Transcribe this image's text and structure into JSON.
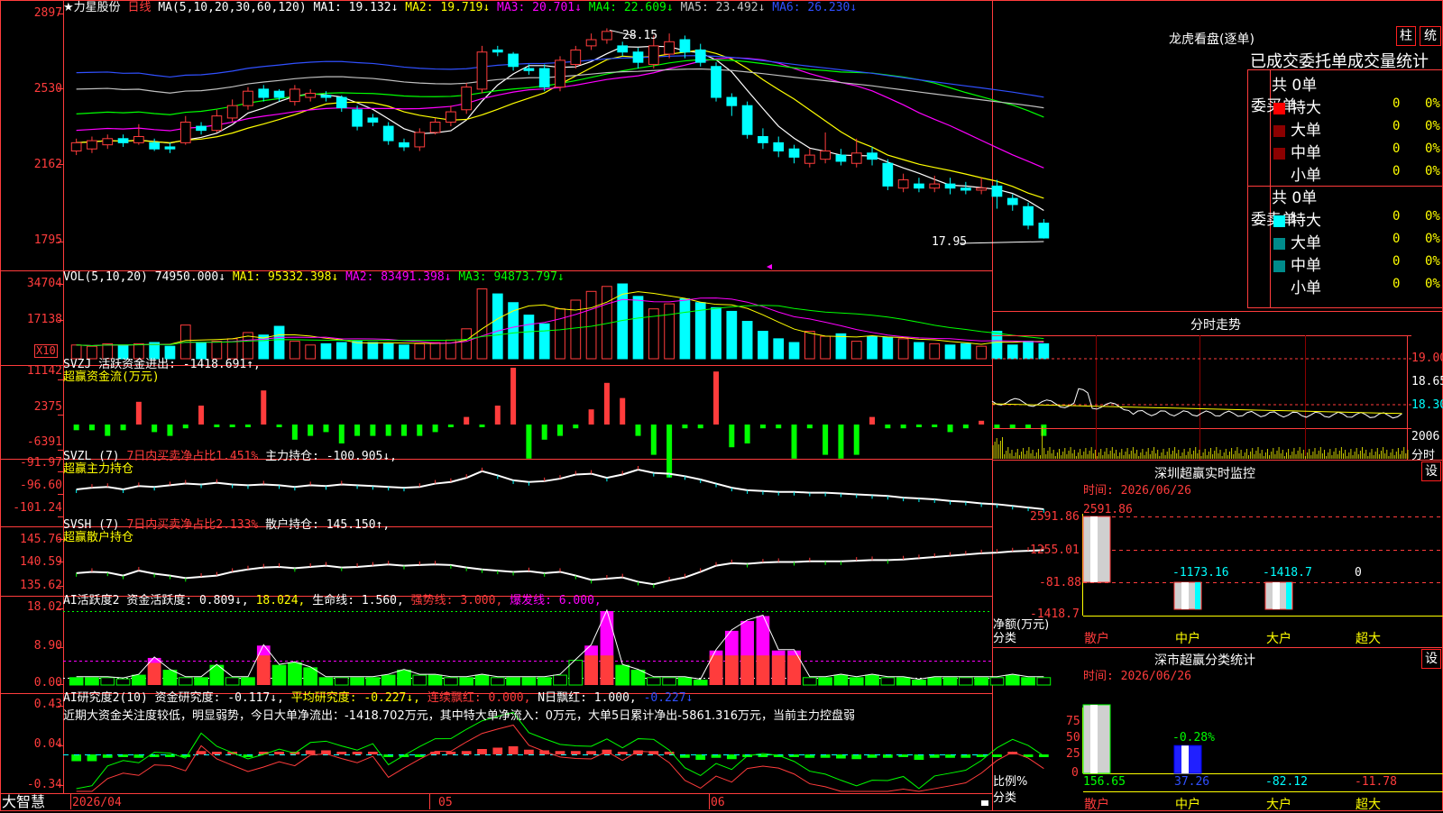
{
  "stock": {
    "name": "★力星股份",
    "period": "日线"
  },
  "main_panel": {
    "ma_header": "MA(5,10,20,30,60,120)",
    "ma1": "MA1: 19.132↓",
    "ma2": "MA2: 19.719↓",
    "ma3": "MA3: 20.701↓",
    "ma4": "MA4: 22.609↓",
    "ma5": "MA5: 23.492↓",
    "ma6": "MA6: 26.230↓",
    "y_ticks": [
      "2897",
      "2530",
      "2162",
      "1795"
    ],
    "high_marker": "28.15",
    "low_marker": "17.95"
  },
  "vol_panel": {
    "header": "VOL(5,10,20)",
    "value": "74950.000↓",
    "ma1": "MA1: 95332.398↓",
    "ma2": "MA2: 83491.398↓",
    "ma3": "MA3: 94873.797↓",
    "y_ticks": [
      "34704",
      "17138"
    ],
    "unit": "X10"
  },
  "svzj_panel": {
    "line1_name": "SVZJ",
    "line1_value": "活跃资金进出: -1418.691↑,",
    "line2": "超赢资金流(万元)",
    "y_ticks": [
      "11142",
      "2375",
      "-6391"
    ]
  },
  "svzl_panel": {
    "name": "SVZL (7)",
    "ratio": "7日内买卖净占比1.451%",
    "hold": "主力持仓: -100.905↓,",
    "line2": "超赢主力持仓",
    "y_ticks": [
      "-91.97",
      "-96.60",
      "-101.24"
    ]
  },
  "svsh_panel": {
    "name": "SVSH (7)",
    "ratio": "7日内买卖净占比2.133%",
    "hold": "散户持仓: 145.150↑,",
    "line2": "超赢散户持仓",
    "y_ticks": [
      "145.76",
      "140.59",
      "135.62"
    ]
  },
  "ai_active_panel": {
    "name": "AI活跃度2",
    "activity": "资金活跃度: 0.809↓,",
    "v2": "18.024,",
    "life": "生命线: 1.560,",
    "strong": "强势线: 3.000,",
    "burst": "爆发线: 6.000,",
    "y_ticks": [
      "18.02",
      "8.90",
      "0.00"
    ]
  },
  "ai_research_panel": {
    "name": "AI研究度2(10)",
    "research": "资金研究度: -0.117↓,",
    "avg": "平均研究度: -0.227↓,",
    "red": "连续飘红: 0.000,",
    "nred": "N日飘红: 1.000,",
    "last": "-0.227↓",
    "comment": "近期大资金关注度较低，明显弱势，今日大单净流出：-1418.702万元，其中特大单净流入：0万元，大单5日累计净出-5861.316万元，当前主力控盘弱",
    "y_ticks": [
      "0.43",
      "0.04",
      "-0.34"
    ]
  },
  "x_axis": {
    "brand": "大智慧",
    "date1": "2026/04",
    "date2": "05",
    "date3": "06"
  },
  "dragon_tiger": {
    "title": "龙虎看盘(逐单)",
    "btn_col": "柱",
    "btn_stat": "统",
    "subtitle": "已成交委托单成交量统计",
    "buy_label": "委买单",
    "sell_label": "委卖单",
    "buy_total": "共 0单",
    "sell_total": "共 0单",
    "rows": [
      {
        "label": "特大",
        "count": "0",
        "pct": "0%"
      },
      {
        "label": "大单",
        "count": "0",
        "pct": "0%"
      },
      {
        "label": "中单",
        "count": "0",
        "pct": "0%"
      },
      {
        "label": "小单",
        "count": "0",
        "pct": "0%"
      }
    ],
    "colors": {
      "buy": [
        "#ff0000",
        "#8b0000",
        "#8b0000"
      ],
      "sell": [
        "#00ffff",
        "#008b8b",
        "#008b8b"
      ]
    }
  },
  "intraday": {
    "title": "分时走势",
    "right_ticks": [
      "19.00",
      "18.65",
      "18.30",
      "2006"
    ],
    "label_min": "分时"
  },
  "monitor": {
    "title": "深圳超赢实时监控",
    "btn": "设",
    "time": "时间: 2026/06/26",
    "y_ticks": [
      "2591.86",
      "1255.01",
      "-81.88",
      "-1418.7"
    ],
    "y_label": "净额(万元)",
    "x_label": "分类",
    "bars": [
      {
        "cat": "散户",
        "value": 2591.86,
        "label": "2591.86"
      },
      {
        "cat": "中户",
        "value": -1173.16,
        "label": "-1173.16"
      },
      {
        "cat": "大户",
        "value": -1418.7,
        "label": "-1418.7"
      },
      {
        "cat": "超大",
        "value": 0,
        "label": "0"
      }
    ]
  },
  "classify": {
    "title": "深市超赢分类统计",
    "btn": "设",
    "time": "时间: 2026/06/26",
    "y_ticks": [
      "75",
      "50",
      "25",
      "0"
    ],
    "y_label": "比例%",
    "x_label": "分类",
    "bars": [
      {
        "cat": "散户",
        "value": 156.65,
        "label": "156.65"
      },
      {
        "cat": "中户",
        "value": 37.26,
        "label": "37.26",
        "annot": "-0.28%"
      },
      {
        "cat": "大户",
        "value": -82.12,
        "label": "-82.12"
      },
      {
        "cat": "超大",
        "value": -11.78,
        "label": "-11.78"
      }
    ]
  },
  "chart_data": {
    "type": "candlestick",
    "title": "力星股份 日线",
    "y_range_price": [
      17.95,
      28.97
    ],
    "candles": [
      {
        "o": 22.2,
        "c": 22.6,
        "h": 22.8,
        "l": 22.0
      },
      {
        "o": 22.3,
        "c": 22.7,
        "h": 22.9,
        "l": 22.1
      },
      {
        "o": 22.5,
        "c": 22.8,
        "h": 23.0,
        "l": 22.3
      },
      {
        "o": 22.8,
        "c": 22.6,
        "h": 23.0,
        "l": 22.4
      },
      {
        "o": 22.6,
        "c": 22.9,
        "h": 23.5,
        "l": 22.5
      },
      {
        "o": 22.6,
        "c": 22.3,
        "h": 22.8,
        "l": 22.2
      },
      {
        "o": 22.4,
        "c": 22.3,
        "h": 22.6,
        "l": 22.1
      },
      {
        "o": 22.6,
        "c": 23.6,
        "h": 23.9,
        "l": 22.5
      },
      {
        "o": 23.4,
        "c": 23.2,
        "h": 23.6,
        "l": 23.0
      },
      {
        "o": 23.2,
        "c": 23.9,
        "h": 24.2,
        "l": 23.1
      },
      {
        "o": 23.8,
        "c": 24.4,
        "h": 24.7,
        "l": 23.6
      },
      {
        "o": 24.4,
        "c": 25.1,
        "h": 25.3,
        "l": 24.2
      },
      {
        "o": 25.2,
        "c": 24.8,
        "h": 25.4,
        "l": 24.6
      },
      {
        "o": 25.1,
        "c": 24.8,
        "h": 25.2,
        "l": 24.6
      },
      {
        "o": 24.6,
        "c": 25.2,
        "h": 25.4,
        "l": 24.4
      },
      {
        "o": 24.8,
        "c": 25.0,
        "h": 25.2,
        "l": 24.6
      },
      {
        "o": 24.9,
        "c": 24.8,
        "h": 25.1,
        "l": 24.6
      },
      {
        "o": 24.8,
        "c": 24.3,
        "h": 24.9,
        "l": 24.1
      },
      {
        "o": 24.2,
        "c": 23.4,
        "h": 24.4,
        "l": 23.2
      },
      {
        "o": 23.8,
        "c": 23.6,
        "h": 24.0,
        "l": 23.4
      },
      {
        "o": 23.4,
        "c": 22.7,
        "h": 23.6,
        "l": 22.5
      },
      {
        "o": 22.6,
        "c": 22.4,
        "h": 22.8,
        "l": 22.2
      },
      {
        "o": 22.4,
        "c": 23.1,
        "h": 23.3,
        "l": 22.2
      },
      {
        "o": 23.1,
        "c": 23.6,
        "h": 23.8,
        "l": 23.0
      },
      {
        "o": 23.6,
        "c": 24.1,
        "h": 24.4,
        "l": 23.4
      },
      {
        "o": 24.2,
        "c": 25.3,
        "h": 25.5,
        "l": 24.0
      },
      {
        "o": 25.2,
        "c": 27.0,
        "h": 27.3,
        "l": 25.0
      },
      {
        "o": 27.1,
        "c": 27.0,
        "h": 27.3,
        "l": 26.8
      },
      {
        "o": 26.9,
        "c": 26.3,
        "h": 27.0,
        "l": 26.1
      },
      {
        "o": 26.2,
        "c": 26.1,
        "h": 26.4,
        "l": 25.9
      },
      {
        "o": 26.2,
        "c": 25.3,
        "h": 26.4,
        "l": 25.1
      },
      {
        "o": 25.3,
        "c": 26.6,
        "h": 26.8,
        "l": 25.1
      },
      {
        "o": 26.4,
        "c": 27.1,
        "h": 27.3,
        "l": 26.2
      },
      {
        "o": 27.3,
        "c": 27.6,
        "h": 27.9,
        "l": 27.1
      },
      {
        "o": 27.6,
        "c": 28.0,
        "h": 28.15,
        "l": 27.4
      },
      {
        "o": 27.3,
        "c": 27.0,
        "h": 27.5,
        "l": 26.8
      },
      {
        "o": 27.0,
        "c": 26.5,
        "h": 27.2,
        "l": 26.2
      },
      {
        "o": 26.4,
        "c": 27.3,
        "h": 27.8,
        "l": 26.2
      },
      {
        "o": 26.9,
        "c": 27.5,
        "h": 27.9,
        "l": 26.7
      },
      {
        "o": 27.6,
        "c": 27.0,
        "h": 27.8,
        "l": 26.7
      },
      {
        "o": 27.1,
        "c": 26.5,
        "h": 27.4,
        "l": 26.3
      },
      {
        "o": 26.3,
        "c": 24.8,
        "h": 26.5,
        "l": 24.6
      },
      {
        "o": 24.8,
        "c": 24.4,
        "h": 25.0,
        "l": 23.9
      },
      {
        "o": 24.4,
        "c": 23.0,
        "h": 24.6,
        "l": 22.8
      },
      {
        "o": 22.9,
        "c": 22.6,
        "h": 23.3,
        "l": 22.3
      },
      {
        "o": 22.6,
        "c": 22.2,
        "h": 22.9,
        "l": 21.9
      },
      {
        "o": 22.3,
        "c": 21.9,
        "h": 22.5,
        "l": 21.6
      },
      {
        "o": 21.6,
        "c": 22.0,
        "h": 22.3,
        "l": 21.4
      },
      {
        "o": 21.8,
        "c": 22.2,
        "h": 23.1,
        "l": 21.6
      },
      {
        "o": 22.0,
        "c": 21.7,
        "h": 22.3,
        "l": 21.5
      },
      {
        "o": 21.6,
        "c": 22.1,
        "h": 22.8,
        "l": 21.4
      },
      {
        "o": 22.1,
        "c": 21.8,
        "h": 22.4,
        "l": 21.5
      },
      {
        "o": 21.6,
        "c": 20.5,
        "h": 21.8,
        "l": 20.3
      },
      {
        "o": 20.4,
        "c": 20.8,
        "h": 21.1,
        "l": 20.2
      },
      {
        "o": 20.6,
        "c": 20.4,
        "h": 20.9,
        "l": 20.2
      },
      {
        "o": 20.4,
        "c": 20.6,
        "h": 21.0,
        "l": 20.2
      },
      {
        "o": 20.6,
        "c": 20.4,
        "h": 20.9,
        "l": 20.1
      },
      {
        "o": 20.4,
        "c": 20.3,
        "h": 20.7,
        "l": 20.1
      },
      {
        "o": 20.3,
        "c": 20.4,
        "h": 20.9,
        "l": 20.1
      },
      {
        "o": 20.5,
        "c": 20.0,
        "h": 20.8,
        "l": 19.4
      },
      {
        "o": 19.9,
        "c": 19.6,
        "h": 20.1,
        "l": 19.3
      },
      {
        "o": 19.5,
        "c": 18.6,
        "h": 19.7,
        "l": 18.4
      },
      {
        "o": 18.7,
        "c": 17.98,
        "h": 18.9,
        "l": 17.95
      }
    ],
    "volume": [
      11,
      10,
      12,
      11,
      12,
      13,
      10,
      27,
      13,
      14,
      16,
      21,
      19,
      26,
      14,
      11,
      12,
      13,
      14,
      13,
      12,
      11,
      12,
      13,
      15,
      24,
      56,
      52,
      45,
      35,
      28,
      40,
      47,
      54,
      58,
      60,
      50,
      40,
      44,
      48,
      45,
      41,
      38,
      30,
      22,
      16,
      13,
      22,
      18,
      20,
      14,
      18,
      17,
      16,
      13,
      12,
      11,
      12,
      10,
      22,
      11,
      14,
      12
    ],
    "svzj": [
      -1.5,
      -1.5,
      -3,
      -1.5,
      6,
      -2,
      -3,
      -1,
      5,
      0,
      0,
      0,
      9,
      0,
      -4,
      -3,
      -2,
      -5,
      -3,
      -3,
      -3,
      -3,
      -3,
      -2,
      0,
      2,
      0,
      5,
      15,
      -9,
      -4,
      -3,
      -1,
      4,
      11,
      7,
      -3,
      -8,
      -14,
      -1,
      -1,
      14,
      -6,
      -5,
      -1,
      -1,
      -9,
      -1,
      -8,
      -9,
      -8,
      2,
      -1,
      -1,
      0,
      0,
      -2,
      -1,
      1,
      -1,
      -1,
      -1,
      -3,
      -3,
      -3
    ],
    "svzl": [
      -97.6,
      -97.4,
      -97.3,
      -97.6,
      -97.2,
      -97.3,
      -97.1,
      -96.9,
      -97.0,
      -96.8,
      -97.0,
      -97.1,
      -97.0,
      -97.1,
      -97.3,
      -97.1,
      -97.2,
      -97.0,
      -97.1,
      -97.2,
      -97.3,
      -97.4,
      -97.3,
      -96.9,
      -96.7,
      -96.2,
      -95.4,
      -95.9,
      -96.5,
      -96.7,
      -96.6,
      -96.3,
      -95.8,
      -95.7,
      -96.2,
      -95.8,
      -95.2,
      -95.6,
      -95.7,
      -96.0,
      -96.4,
      -96.9,
      -97.4,
      -97.7,
      -97.8,
      -97.9,
      -97.9,
      -98.0,
      -98.0,
      -98.1,
      -98.2,
      -98.3,
      -98.4,
      -98.6,
      -98.7,
      -98.8,
      -99.0,
      -99.1,
      -99.3,
      -99.4,
      -99.6,
      -99.8,
      -100.0,
      -100.5,
      -100.9
    ],
    "svsh": [
      140.0,
      140.2,
      140.1,
      139.6,
      140.4,
      139.9,
      139.6,
      139.2,
      139.4,
      139.6,
      140.2,
      140.6,
      140.9,
      141.0,
      140.8,
      141.0,
      141.2,
      140.9,
      141.0,
      141.2,
      141.4,
      141.2,
      141.3,
      141.4,
      141.3,
      140.9,
      140.6,
      140.4,
      140.2,
      140.3,
      140.0,
      140.2,
      139.6,
      138.9,
      139.1,
      139.3,
      138.6,
      138.2,
      138.8,
      139.3,
      140.2,
      141.2,
      141.6,
      141.5,
      141.7,
      141.8,
      141.8,
      141.9,
      141.9,
      141.9,
      142.0,
      142.1,
      142.1,
      142.2,
      142.4,
      142.6,
      142.8,
      143.0,
      143.2,
      143.3,
      143.5,
      143.6,
      143.7,
      144.2,
      145.1
    ],
    "ai_active": [
      3,
      3,
      3,
      2.5,
      4,
      11,
      6,
      3,
      3,
      8,
      3,
      3,
      16,
      8,
      9,
      7,
      3,
      3,
      3,
      3,
      4,
      6,
      4,
      4,
      3,
      3,
      4,
      3,
      3,
      3,
      3,
      4,
      10,
      16,
      30,
      8,
      6,
      3,
      3,
      3,
      2,
      14,
      22,
      26,
      28,
      14,
      14,
      3,
      3,
      4,
      3,
      4,
      3,
      3,
      2,
      3,
      3,
      3,
      3,
      3,
      4,
      3,
      3,
      3,
      4,
      3,
      3,
      3,
      3,
      4,
      3,
      3,
      3,
      2,
      3
    ],
    "ai_active_red": [
      0,
      0,
      0,
      0,
      0,
      9,
      0,
      0,
      0,
      0,
      0,
      0,
      0,
      0,
      0,
      0,
      0,
      0,
      0,
      0,
      0,
      0,
      0,
      0,
      0,
      0,
      0,
      0,
      0,
      0,
      0,
      0,
      0,
      12,
      20,
      0,
      0,
      0,
      0,
      0,
      0,
      12,
      12,
      12,
      12,
      12,
      12,
      0,
      0,
      0,
      0,
      0,
      0,
      0,
      0,
      0,
      0,
      0,
      0,
      0,
      0,
      0,
      0,
      0,
      0,
      0,
      0,
      0,
      0,
      0,
      0,
      0,
      0,
      0,
      0
    ],
    "ai_research": [
      -0.1,
      -0.1,
      -0.05,
      -0.04,
      -0.05,
      -0.02,
      -0.02,
      -0.03,
      0.05,
      0.02,
      0.01,
      0.0,
      0.02,
      0.04,
      0.03,
      0.06,
      0.06,
      0.04,
      0.02,
      0.03,
      -0.04,
      -0.02,
      0.0,
      0.02,
      0.02,
      0.05,
      0.08,
      0.1,
      0.12,
      0.07,
      0.06,
      0.05,
      0.05,
      0.05,
      0.07,
      0.04,
      0.06,
      0.05,
      0.01,
      -0.05,
      -0.08,
      -0.05,
      -0.07,
      -0.03,
      -0.02,
      -0.02,
      -0.03,
      -0.05,
      -0.05,
      -0.06,
      -0.07,
      -0.05,
      -0.05,
      -0.04,
      -0.08,
      -0.05,
      -0.05,
      -0.05,
      -0.03,
      0.0,
      0.02,
      0.0,
      -0.03,
      -0.05,
      -0.12
    ]
  }
}
